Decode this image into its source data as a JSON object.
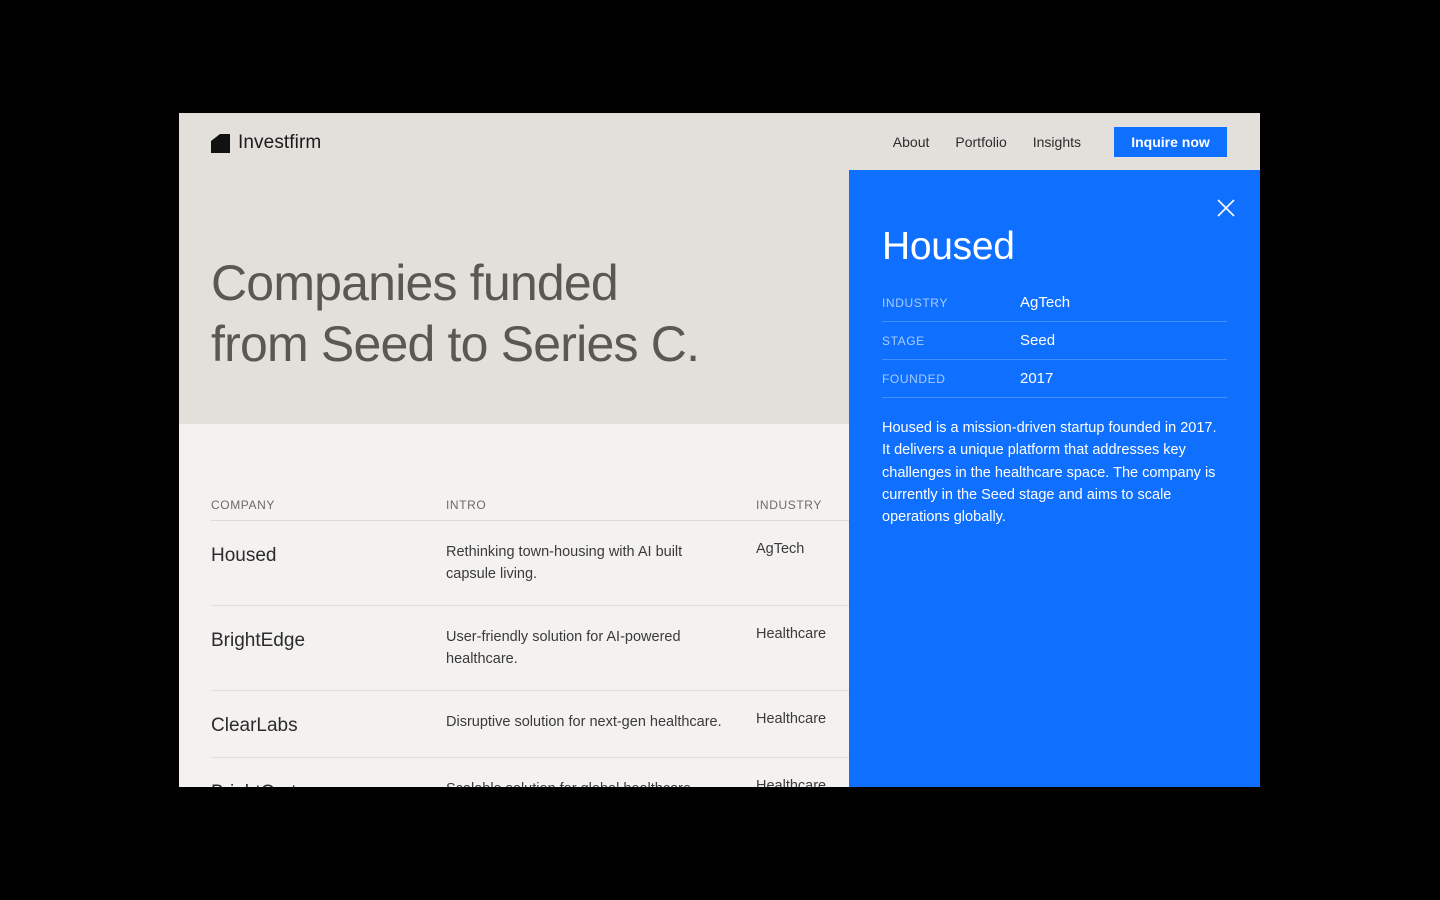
{
  "brand": {
    "name": "Investfirm"
  },
  "nav": {
    "links": [
      "About",
      "Portfolio",
      "Insights"
    ],
    "cta": "Inquire now"
  },
  "hero": {
    "line1": "Companies funded",
    "line2": "from Seed to Series C."
  },
  "table": {
    "headers": {
      "company": "COMPANY",
      "intro": "INTRO",
      "industry": "INDUSTRY"
    },
    "rows": [
      {
        "company": "Housed",
        "intro": "Rethinking town-housing with AI built capsule living.",
        "industry": "AgTech"
      },
      {
        "company": "BrightEdge",
        "intro": "User-friendly solution for AI-powered healthcare.",
        "industry": "Healthcare"
      },
      {
        "company": "ClearLabs",
        "intro": "Disruptive solution for next-gen healthcare.",
        "industry": "Healthcare"
      },
      {
        "company": "BrightCart",
        "intro": "Scalable solution for global healthcare.",
        "industry": "Healthcare"
      }
    ]
  },
  "panel": {
    "title": "Housed",
    "details": [
      {
        "label": "INDUSTRY",
        "value": "AgTech"
      },
      {
        "label": "STAGE",
        "value": "Seed"
      },
      {
        "label": "FOUNDED",
        "value": "2017"
      }
    ],
    "description": "Housed is a mission-driven startup founded in 2017. It delivers a unique platform that addresses key challenges in the healthcare space. The company is currently in the Seed stage and aims to scale operations globally."
  },
  "colors": {
    "accent": "#0f6fff",
    "hero_bg": "#e3e0dc",
    "page_bg": "#f4f2f0",
    "outer_bg": "#000000"
  },
  "icons": {
    "logo": "logo-mark",
    "close": "close-icon"
  }
}
